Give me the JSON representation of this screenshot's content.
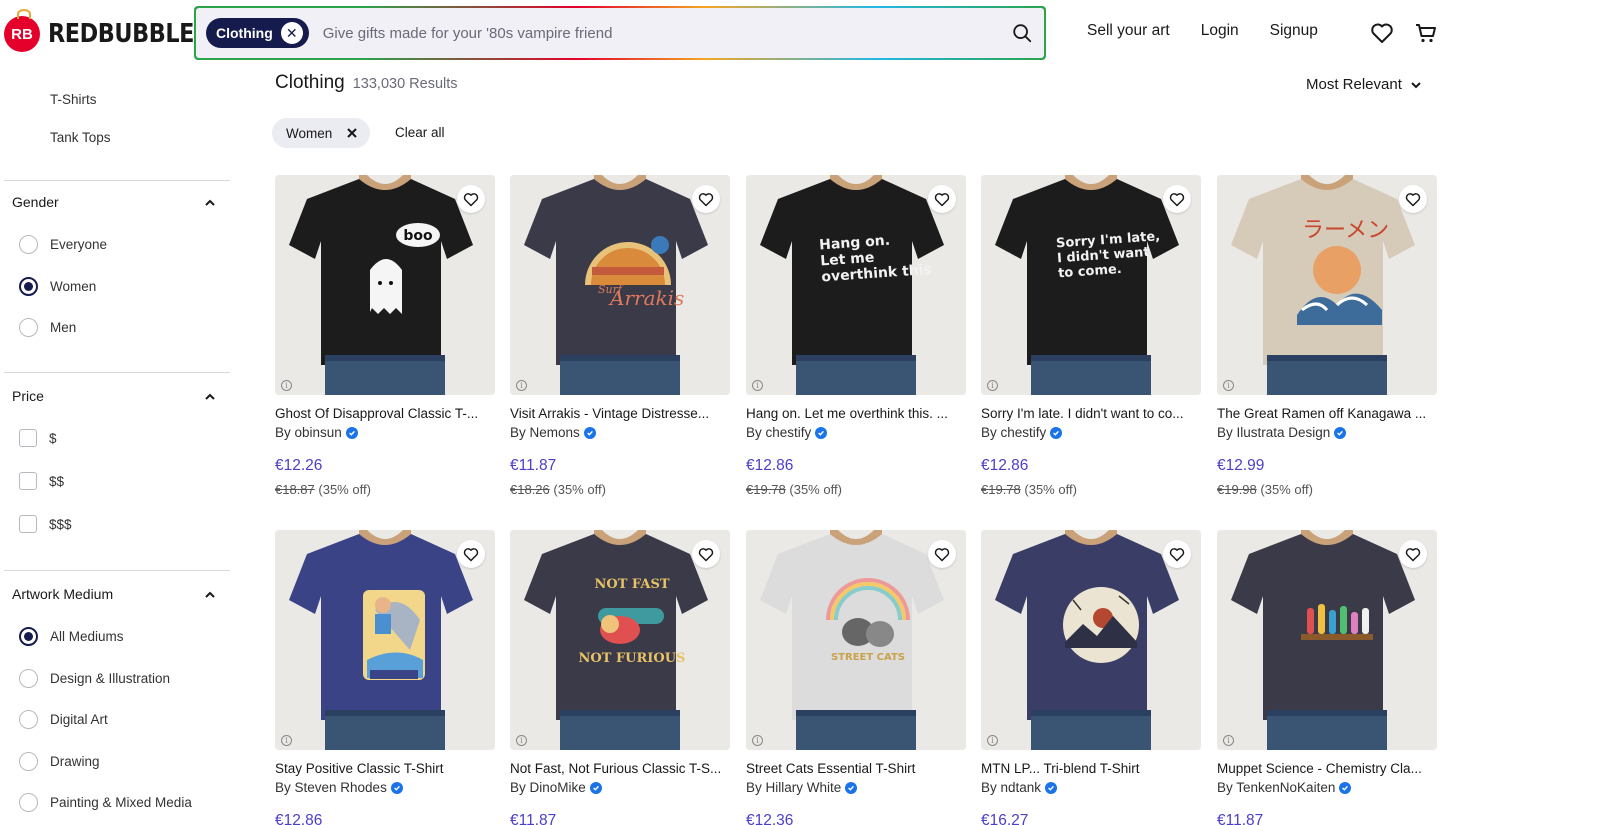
{
  "brand": {
    "name": "REDBUBBLE",
    "mark": "RB"
  },
  "search": {
    "chip": "Clothing",
    "placeholder": "Give gifts made for your '80s vampire friend"
  },
  "nav": {
    "sell": "Sell your art",
    "login": "Login",
    "signup": "Signup"
  },
  "sidebar": {
    "sub_links": [
      "T-Shirts",
      "Tank Tops"
    ],
    "gender": {
      "title": "Gender",
      "options": [
        "Everyone",
        "Women",
        "Men"
      ],
      "selected": "Women"
    },
    "price": {
      "title": "Price",
      "options": [
        "$",
        "$$",
        "$$$"
      ]
    },
    "medium": {
      "title": "Artwork Medium",
      "options": [
        "All Mediums",
        "Design & Illustration",
        "Digital Art",
        "Drawing",
        "Painting & Mixed Media"
      ],
      "selected": "All Mediums"
    }
  },
  "results": {
    "title": "Clothing",
    "count": "133,030 Results",
    "sort": "Most Relevant"
  },
  "filters": {
    "active": "Women",
    "clear": "Clear all"
  },
  "products": [
    {
      "title": "Ghost Of Disapproval Classic T-...",
      "by": "By obinsun",
      "price": "€12.26",
      "was": "€18.87",
      "off": "(35% off)",
      "shirt": "#1c1c1c",
      "print": "ghost"
    },
    {
      "title": "Visit Arrakis - Vintage Distresse...",
      "by": "By Nemons",
      "price": "€11.87",
      "was": "€18.26",
      "off": "(35% off)",
      "shirt": "#3a3a48",
      "print": "arrakis"
    },
    {
      "title": "Hang on. Let me overthink this. ...",
      "by": "By chestify",
      "price": "€12.86",
      "was": "€19.78",
      "off": "(35% off)",
      "shirt": "#1c1c1c",
      "print": "text1"
    },
    {
      "title": "Sorry I'm late. I didn't want to co...",
      "by": "By chestify",
      "price": "€12.86",
      "was": "€19.78",
      "off": "(35% off)",
      "shirt": "#1c1c1c",
      "print": "text2"
    },
    {
      "title": "The Great Ramen off Kanagawa ...",
      "by": "By Ilustrata Design",
      "price": "€12.99",
      "was": "€19.98",
      "off": "(35% off)",
      "shirt": "#d6cbb8",
      "print": "ramen"
    },
    {
      "title": "Stay Positive Classic T-Shirt",
      "by": "By Steven Rhodes",
      "price": "€12.86",
      "was": "",
      "off": "",
      "shirt": "#3a4385",
      "print": "shark"
    },
    {
      "title": "Not Fast, Not Furious Classic T-S...",
      "by": "By DinoMike",
      "price": "€11.87",
      "was": "",
      "off": "",
      "shirt": "#3a3a48",
      "print": "sloth"
    },
    {
      "title": "Street Cats Essential T-Shirt",
      "by": "By Hillary White",
      "price": "€12.36",
      "was": "",
      "off": "",
      "shirt": "#dcdcdc",
      "print": "cats"
    },
    {
      "title": "MTN LP... Tri-blend T-Shirt",
      "by": "By ndtank",
      "price": "€16.27",
      "was": "",
      "off": "",
      "shirt": "#3a3e66",
      "print": "mtn"
    },
    {
      "title": "Muppet Science - Chemistry Cla...",
      "by": "By TenkenNoKaiten",
      "price": "€11.87",
      "was": "",
      "off": "",
      "shirt": "#3a3a48",
      "print": "muppet"
    }
  ],
  "print_text": {
    "ghost": "boo",
    "arrakis": [
      "Surf",
      "Arrakis"
    ],
    "text1": [
      "Hang on.",
      "Let me",
      "overthink this"
    ],
    "text2": [
      "Sorry I'm late,",
      "I didn't want",
      "to come."
    ],
    "ramen": "ラーメン",
    "sloth": [
      "NOT FAST",
      "NOT FURIOUS"
    ],
    "cats": [
      "STREET CATS"
    ]
  },
  "colors": {
    "accent": "#4b3fc9",
    "navy": "#151b4d",
    "brand_red": "#e4002b"
  }
}
